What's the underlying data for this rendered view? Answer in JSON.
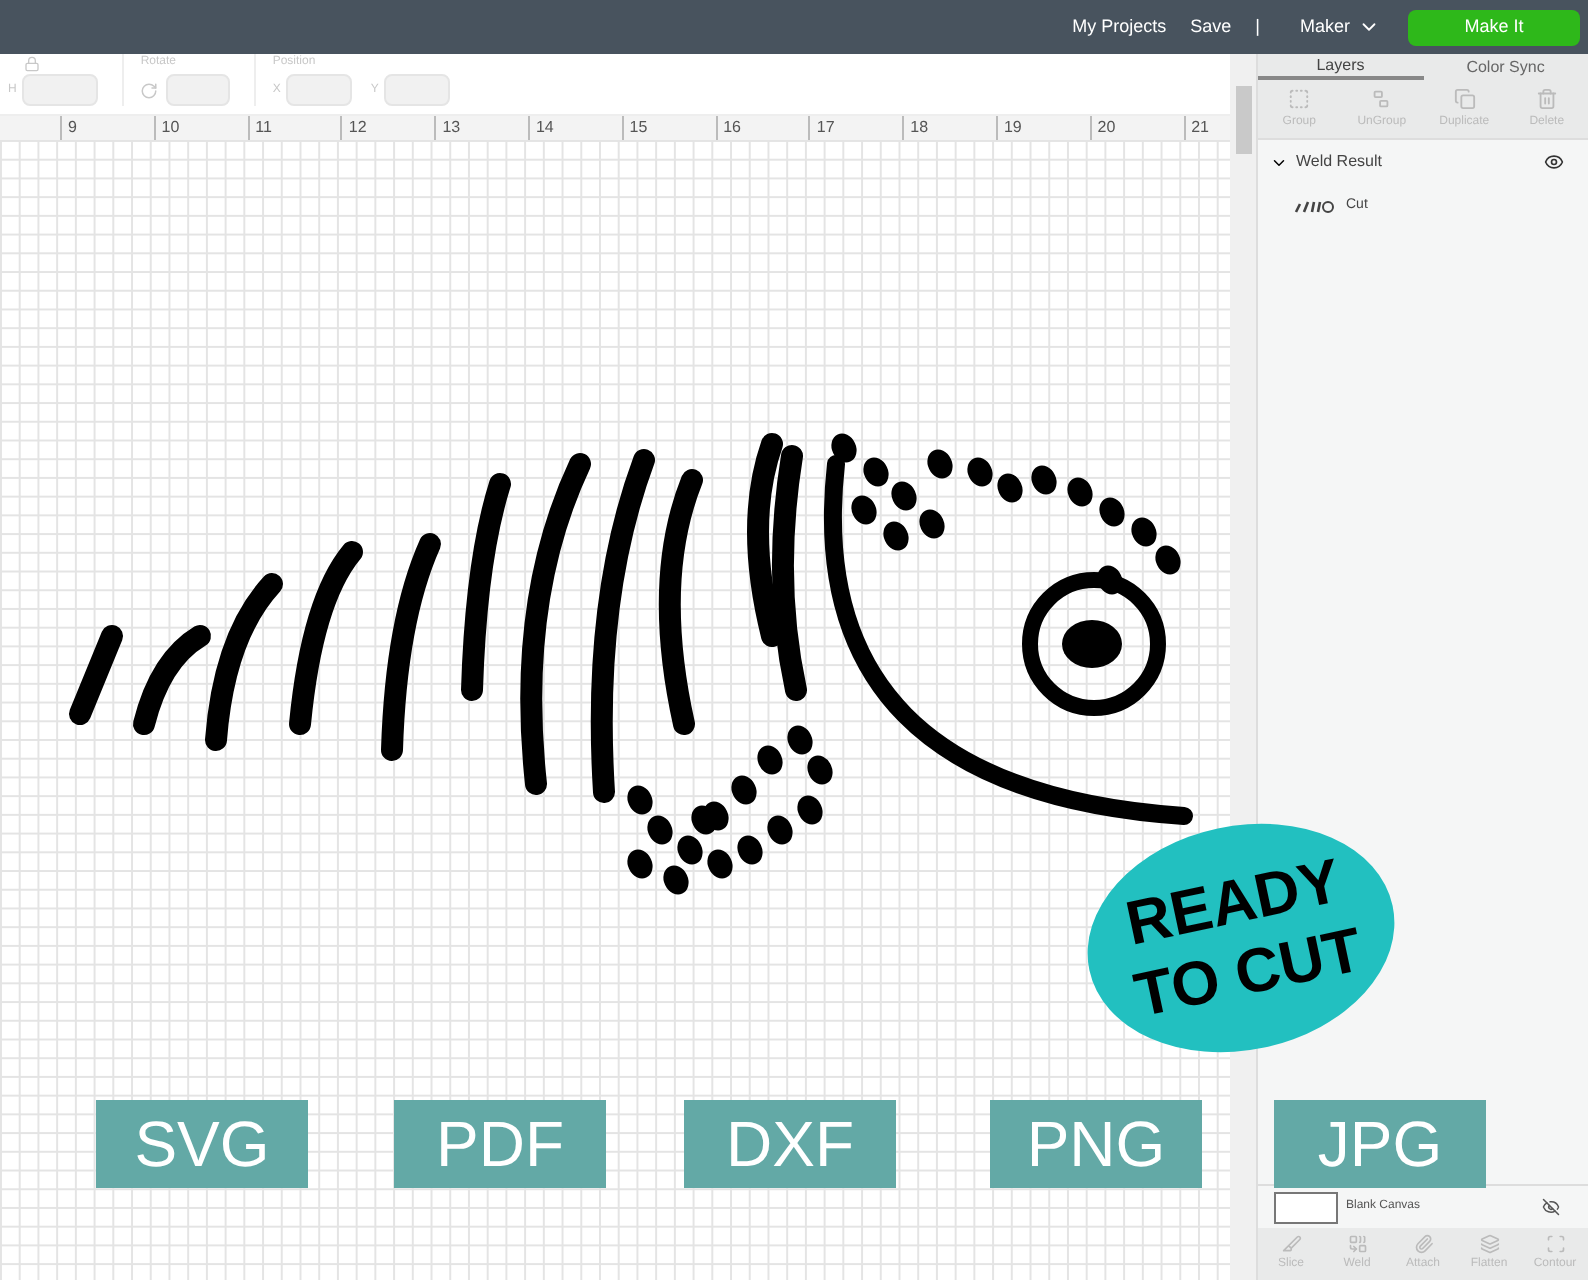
{
  "top_bar": {
    "links": [
      "My Projects",
      "Save"
    ],
    "separator": "|",
    "machine": "Maker",
    "make_button": "Make It"
  },
  "toolbar": {
    "size_label": "H",
    "rotate_label": "Rotate",
    "position_label": "Position",
    "x_label": "X",
    "y_label": "Y"
  },
  "ruler": [
    "9",
    "10",
    "11",
    "12",
    "13",
    "14",
    "15",
    "16",
    "17",
    "18",
    "19",
    "20",
    "21"
  ],
  "layers_panel": {
    "tabs": [
      {
        "label": "Layers",
        "selected": true
      },
      {
        "label": "Color Sync",
        "selected": false
      }
    ],
    "actions": [
      {
        "label": "Group",
        "disabled": true
      },
      {
        "label": "UnGroup",
        "disabled": true
      },
      {
        "label": "Duplicate",
        "disabled": true
      },
      {
        "label": "Delete",
        "disabled": true
      }
    ],
    "group": {
      "name": "Weld Result",
      "expanded": true,
      "children": [
        {
          "name": "Cut"
        }
      ]
    },
    "blank_canvas": "Blank Canvas",
    "bottom_actions": [
      {
        "label": "Slice",
        "disabled": true
      },
      {
        "label": "Weld",
        "disabled": true
      },
      {
        "label": "Attach",
        "disabled": true
      },
      {
        "label": "Flatten",
        "disabled": true
      },
      {
        "label": "Contour",
        "disabled": true
      }
    ]
  },
  "overlay": {
    "badge": "READY TO CUT",
    "formats": [
      "SVG",
      "PDF",
      "DXF",
      "PNG",
      "JPG"
    ]
  }
}
